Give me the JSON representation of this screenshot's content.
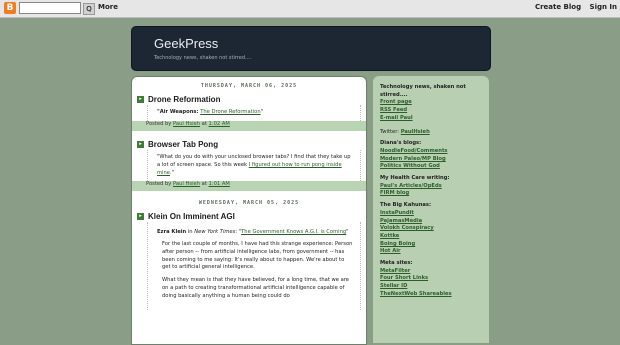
{
  "navbar": {
    "logo": "B",
    "search_placeholder": "",
    "search_button": "Q",
    "more": "More",
    "create_blog": "Create Blog",
    "sign_in": "Sign In"
  },
  "header": {
    "title": "GeekPress",
    "description": "Technology news, shaken not stirred...."
  },
  "posts_day1": {
    "date": "THURSDAY, MARCH 06, 2025",
    "post1": {
      "title": "Drone Reformation",
      "quote_label": "\"Air Weapons:",
      "link": "The Drone Reformation",
      "quote_end": "\"",
      "posted_by": "Posted by",
      "author": "Paul Hsieh",
      "at": "at",
      "time": "1:02 AM"
    },
    "post2": {
      "title": "Browser Tab Pong",
      "body_start": "\"What do you do with your unclosed browser tabs? I find that they take up a lot of screen space. So this week ",
      "link": "I figured out how to run pong inside mine",
      "body_end": ".\"",
      "posted_by": "Posted by",
      "author": "Paul Hsieh",
      "at": "at",
      "time": "1:01 AM"
    }
  },
  "posts_day2": {
    "date": "WEDNESDAY, MARCH 05, 2025",
    "post1": {
      "title": "Klein On Imminent AGI",
      "intro_author": "Ezra Klein",
      "intro_in": " in ",
      "intro_pub": "New York Times",
      "intro_colon": ": \"",
      "link": "The Government Knows A.G.I. is Coming",
      "intro_end": "\"",
      "para1": "For the last couple of months, I have had this strange experience: Person after person -- from artificial intelligence labs, from government -- has been coming to me saying: It's really about to happen. We're about to get to artificial general intelligence.",
      "para2": "What they mean is that they have believed, for a long time, that we are on a path to creating transformational artificial intelligence capable of doing basically anything a human being could do"
    }
  },
  "sidebar": {
    "tagline": "Technology news, shaken not stirred....",
    "links1": [
      "Front page",
      "RSS Feed",
      "E-mail Paul"
    ],
    "twitter_label": "Twitter: ",
    "twitter_link": "PaulHsieh",
    "dianas_head": "Diana's blogs:",
    "dianas_links": [
      "NoodleFood/Comments",
      "Modern Paleo/MP Blog",
      "Politics Without God"
    ],
    "health_head": "My Health Care writing:",
    "health_links": [
      "Paul's Articles/OpEds",
      "FIRM blog"
    ],
    "kahunas_head": "The Big Kahunas:",
    "kahunas_links": [
      "InstaPundit",
      "PajamasMedia",
      "Volokh Conspiracy",
      "Kottke",
      "Boing Boing",
      "Hot Air"
    ],
    "meta_head": "Meta sites:",
    "meta_links": [
      "MetaFilter",
      "Four Short Links",
      "Stellar ID",
      "TheNextWeb Shareables"
    ]
  }
}
